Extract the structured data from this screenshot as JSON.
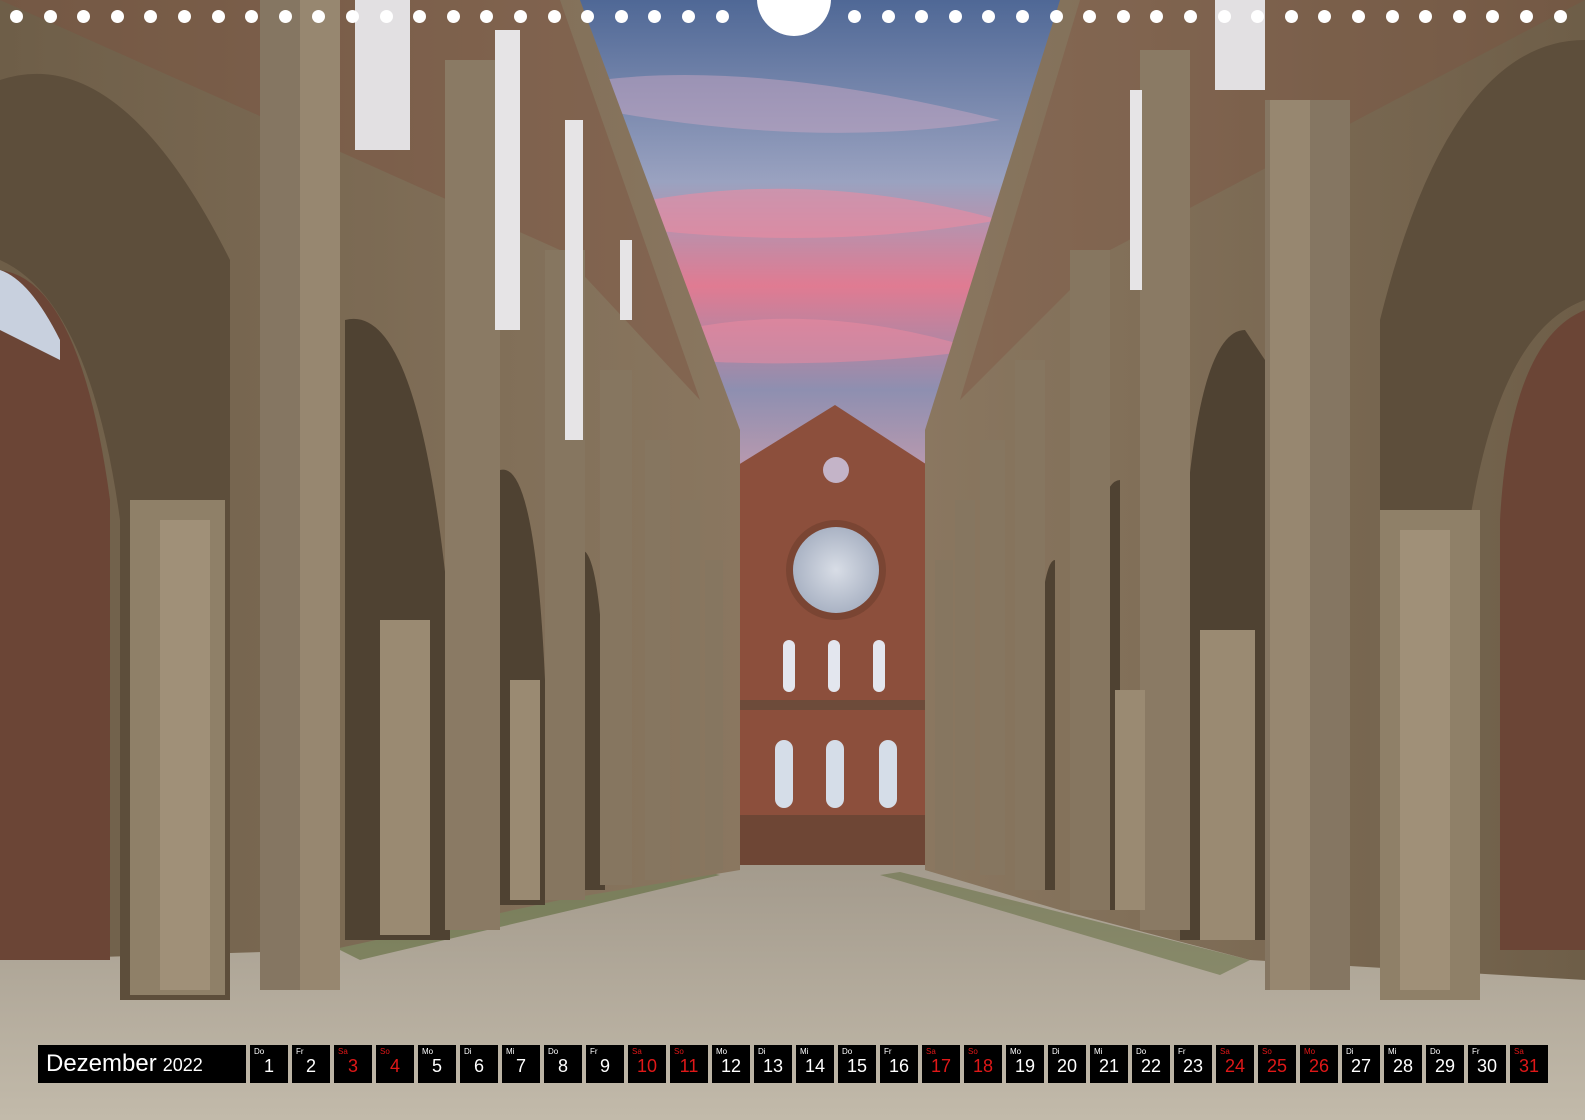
{
  "calendar": {
    "month": "Dezember",
    "year": "2022",
    "weekday_color": "#ffffff",
    "weekend_color": "#e01818",
    "days": [
      {
        "dow": "Do",
        "num": "1",
        "weekend": false
      },
      {
        "dow": "Fr",
        "num": "2",
        "weekend": false
      },
      {
        "dow": "Sa",
        "num": "3",
        "weekend": true
      },
      {
        "dow": "So",
        "num": "4",
        "weekend": true
      },
      {
        "dow": "Mo",
        "num": "5",
        "weekend": false
      },
      {
        "dow": "Di",
        "num": "6",
        "weekend": false
      },
      {
        "dow": "Mi",
        "num": "7",
        "weekend": false
      },
      {
        "dow": "Do",
        "num": "8",
        "weekend": false
      },
      {
        "dow": "Fr",
        "num": "9",
        "weekend": false
      },
      {
        "dow": "Sa",
        "num": "10",
        "weekend": true
      },
      {
        "dow": "So",
        "num": "11",
        "weekend": true
      },
      {
        "dow": "Mo",
        "num": "12",
        "weekend": false
      },
      {
        "dow": "Di",
        "num": "13",
        "weekend": false
      },
      {
        "dow": "Mi",
        "num": "14",
        "weekend": false
      },
      {
        "dow": "Do",
        "num": "15",
        "weekend": false
      },
      {
        "dow": "Fr",
        "num": "16",
        "weekend": false
      },
      {
        "dow": "Sa",
        "num": "17",
        "weekend": true
      },
      {
        "dow": "So",
        "num": "18",
        "weekend": true
      },
      {
        "dow": "Mo",
        "num": "19",
        "weekend": false
      },
      {
        "dow": "Di",
        "num": "20",
        "weekend": false
      },
      {
        "dow": "Mi",
        "num": "21",
        "weekend": false
      },
      {
        "dow": "Do",
        "num": "22",
        "weekend": false
      },
      {
        "dow": "Fr",
        "num": "23",
        "weekend": false
      },
      {
        "dow": "Sa",
        "num": "24",
        "weekend": true
      },
      {
        "dow": "So",
        "num": "25",
        "weekend": true
      },
      {
        "dow": "Mo",
        "num": "26",
        "weekend": true
      },
      {
        "dow": "Di",
        "num": "27",
        "weekend": false
      },
      {
        "dow": "Mi",
        "num": "28",
        "weekend": false
      },
      {
        "dow": "Do",
        "num": "29",
        "weekend": false
      },
      {
        "dow": "Fr",
        "num": "30",
        "weekend": false
      },
      {
        "dow": "Sa",
        "num": "31",
        "weekend": true
      }
    ]
  },
  "photo": {
    "subject": "ruined-abbey-nave-icon",
    "sky_colors": [
      "#5a6f9a",
      "#b8a0b8",
      "#e87a90"
    ],
    "stone_color": "#7a6a55",
    "brick_color": "#8c4a35",
    "gravel_color": "#b8b0a2"
  },
  "binding": {
    "hole_color": "#ffffff"
  }
}
